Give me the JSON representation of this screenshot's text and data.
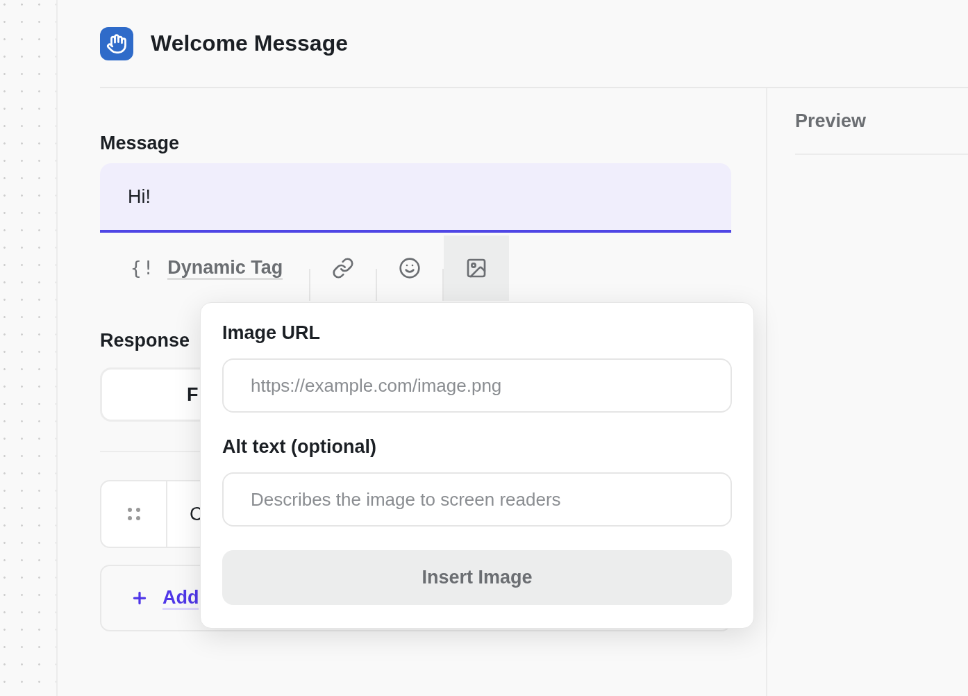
{
  "header": {
    "title": "Welcome Message"
  },
  "message": {
    "label": "Message",
    "value": "Hi!",
    "focused": true
  },
  "toolbar": {
    "dynamic_tag": {
      "icon": "{!",
      "label": "Dynamic Tag"
    },
    "tools": [
      {
        "kind": "link",
        "selected": false
      },
      {
        "kind": "emoji",
        "selected": false
      },
      {
        "kind": "image",
        "selected": true
      }
    ]
  },
  "response": {
    "heading": "Response",
    "button": "F",
    "rows": [
      {
        "text": "C"
      }
    ],
    "add_link": {
      "label": "Add"
    }
  },
  "image_popup": {
    "url_label": "Image URL",
    "url_placeholder": "https://example.com/image.png",
    "alt_label": "Alt text (optional)",
    "alt_placeholder": "Describes the image to screen readers",
    "insert_button": "Insert Image",
    "insert_disabled": true
  },
  "preview": {
    "title": "Preview"
  }
}
